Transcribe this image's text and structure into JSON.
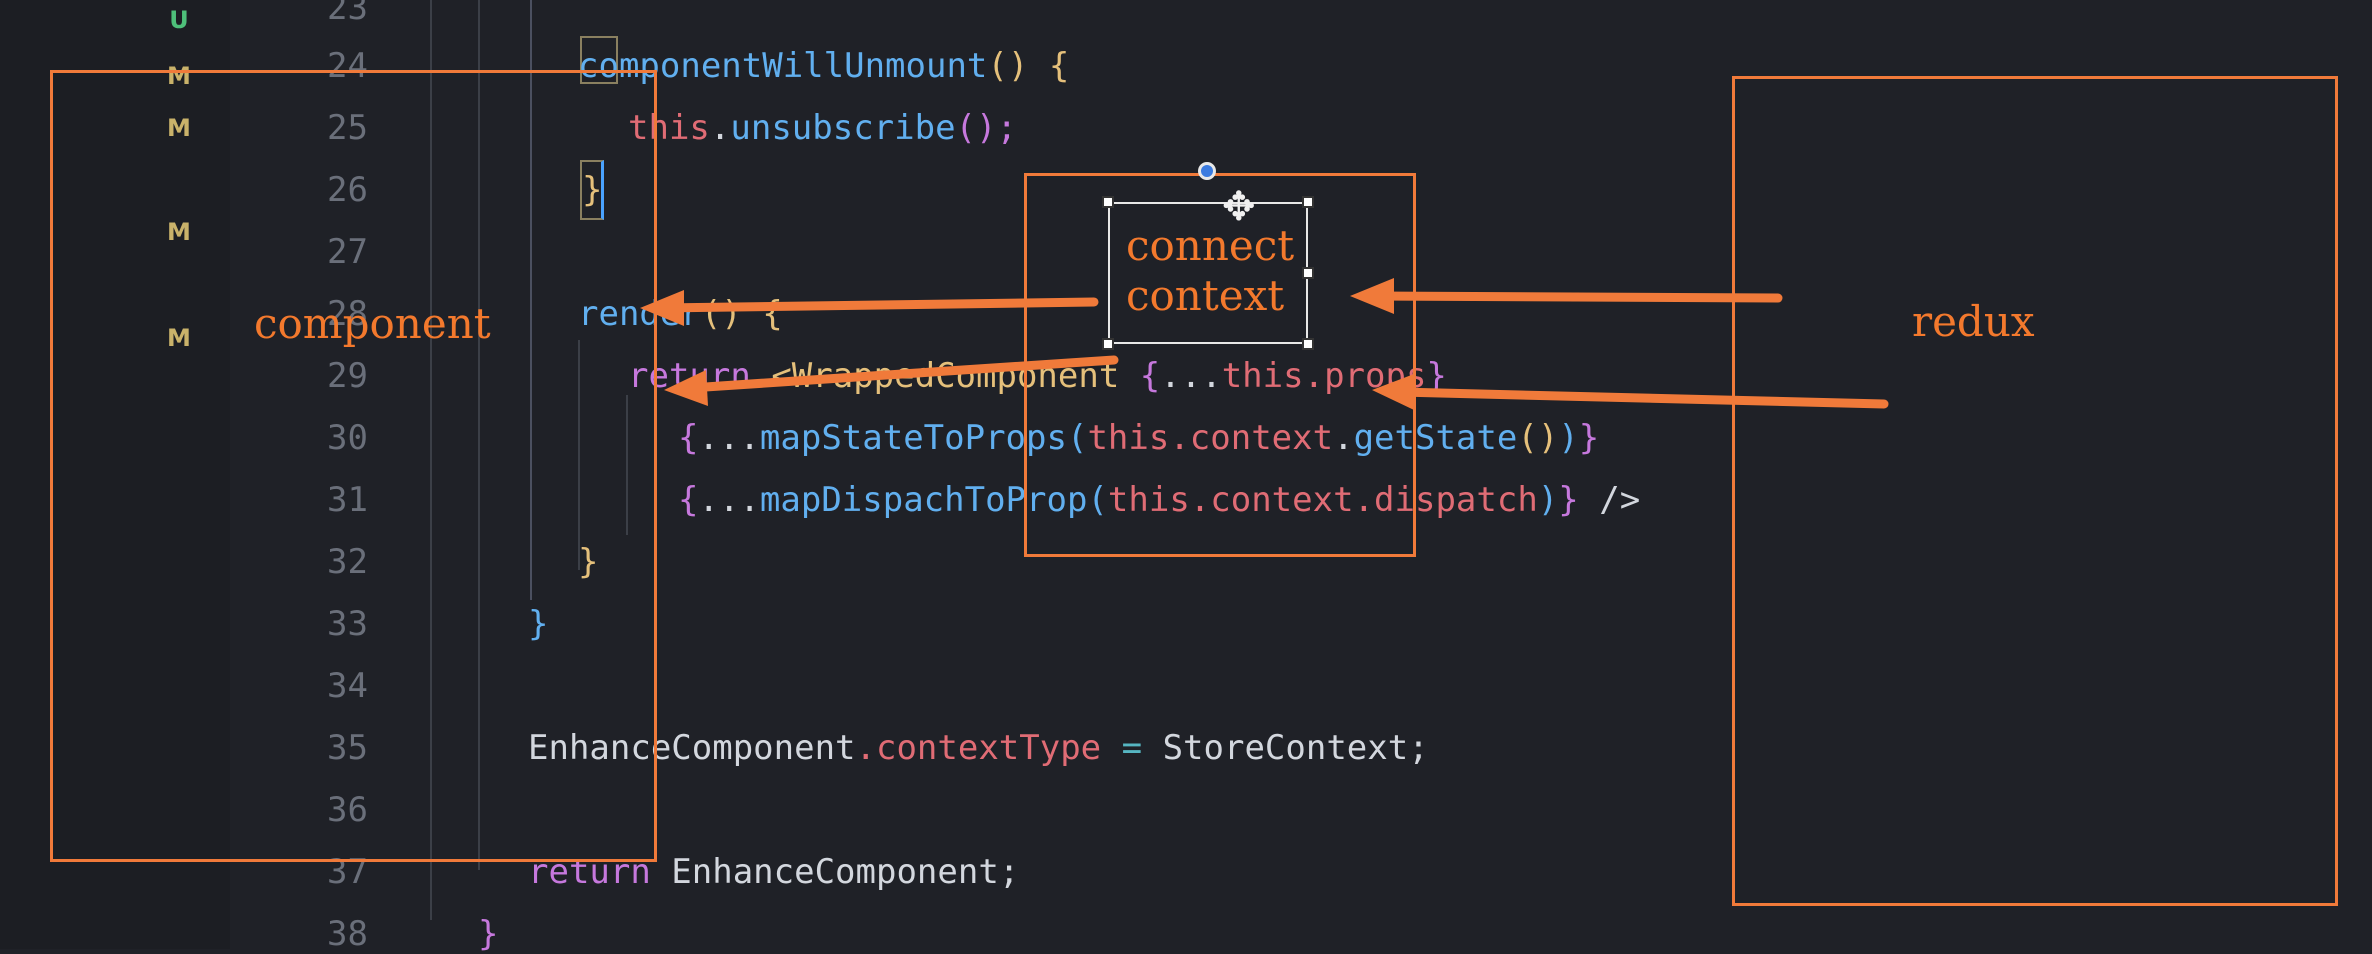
{
  "scm_markers": [
    {
      "line": 23,
      "letter": "U",
      "color": "#4ec07a"
    },
    {
      "line": 24,
      "letter": "M",
      "color": "#c9b26a"
    },
    {
      "line": 25,
      "letter": "M",
      "color": "#c9b26a"
    },
    {
      "line": 27,
      "letter": "M",
      "color": "#c9b26a"
    },
    {
      "line": 29,
      "letter": "M",
      "color": "#c9b26a"
    }
  ],
  "lines": [
    {
      "n": "23"
    },
    {
      "n": "24"
    },
    {
      "n": "25"
    },
    {
      "n": "26"
    },
    {
      "n": "27"
    },
    {
      "n": "28"
    },
    {
      "n": "29"
    },
    {
      "n": "30"
    },
    {
      "n": "31"
    },
    {
      "n": "32"
    },
    {
      "n": "33"
    },
    {
      "n": "34"
    },
    {
      "n": "35"
    },
    {
      "n": "36"
    },
    {
      "n": "37"
    },
    {
      "n": "38"
    }
  ],
  "code": {
    "l24_fn": "componentWillUnmount",
    "l24_paren": "()",
    "l24_brace": "{",
    "l25_this": "this",
    "l25_dot": ".",
    "l25_fn": "unsubscribe",
    "l25_rest": "();",
    "l26_brace": "}",
    "l28_fn": "render",
    "l28_paren": "()",
    "l28_brace": "{",
    "l29_kw": "return",
    "l29_tag": "<WrappedComponent",
    "l29_open": "{",
    "l29_spread": "...",
    "l29_this": "this",
    "l29_prop": ".props",
    "l29_close": "}",
    "l30_open": "{",
    "l30_spread": "...",
    "l30_fn": "mapStateToProps",
    "l30_p1": "(",
    "l30_this": "this",
    "l30_ctx": ".context",
    "l30_dot": ".",
    "l30_call": "getState",
    "l30_p2": "()",
    "l30_p3": ")",
    "l30_close": "}",
    "l31_open": "{",
    "l31_spread": "...",
    "l31_fn": "mapDispachToProp",
    "l31_p1": "(",
    "l31_this": "this",
    "l31_ctx": ".context",
    "l31_disp": ".dispatch",
    "l31_p2": ")",
    "l31_close": "}",
    "l31_end": " />",
    "l32_brace": "}",
    "l33_brace": "}",
    "l35_cls": "EnhanceComponent",
    "l35_prop": ".contextType",
    "l35_eq": " = ",
    "l35_val": "StoreContext;",
    "l37_kw": "return",
    "l37_val": " EnhanceComponent;",
    "l38_brace": "}"
  },
  "annotations": {
    "component_label": "component",
    "connect_label_1": "connect",
    "connect_label_2": "context",
    "redux_label": "redux"
  },
  "colors": {
    "annotation": "#f07a3a",
    "background": "#1f2127"
  }
}
